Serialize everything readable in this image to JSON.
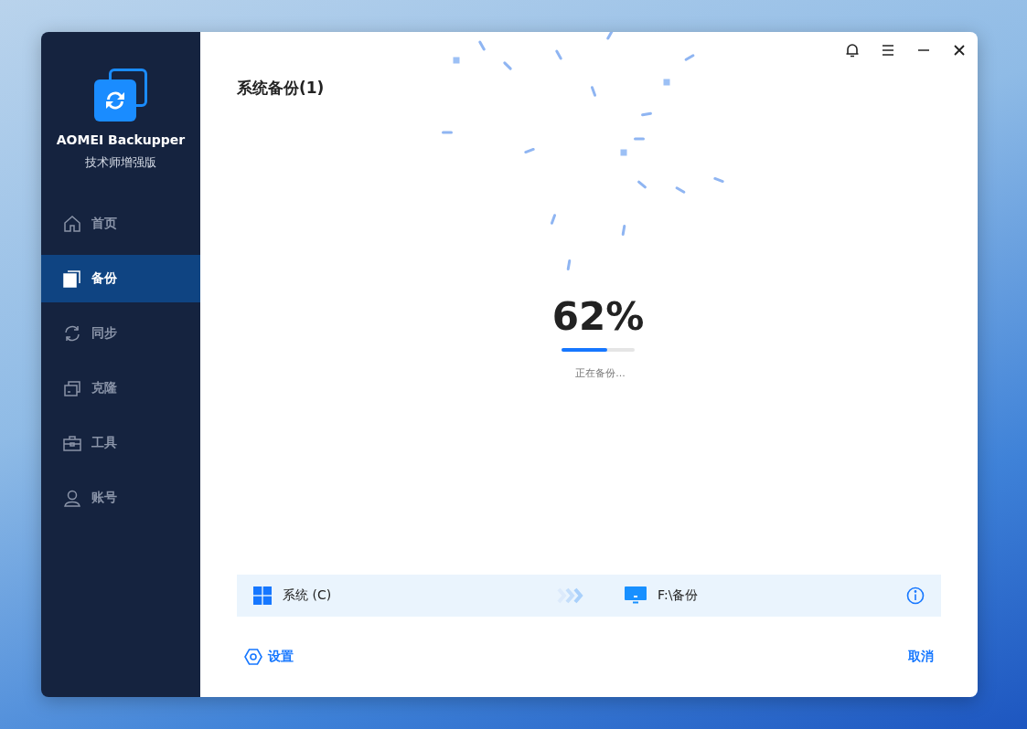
{
  "app": {
    "name": "AOMEI Backupper",
    "edition": "技术师增强版"
  },
  "nav": [
    {
      "label": "首页",
      "selected": false
    },
    {
      "label": "备份",
      "selected": true
    },
    {
      "label": "同步",
      "selected": false
    },
    {
      "label": "克隆",
      "selected": false
    },
    {
      "label": "工具",
      "selected": false
    },
    {
      "label": "账号",
      "selected": false
    }
  ],
  "page_title": "系统备份(1)",
  "progress": {
    "percent": "62%",
    "level": 0.62,
    "status": "正在备份..."
  },
  "route": {
    "source": "系统 (C)",
    "destination": "F:\\备份"
  },
  "footer": {
    "settings": "设置",
    "cancel": "取消"
  }
}
